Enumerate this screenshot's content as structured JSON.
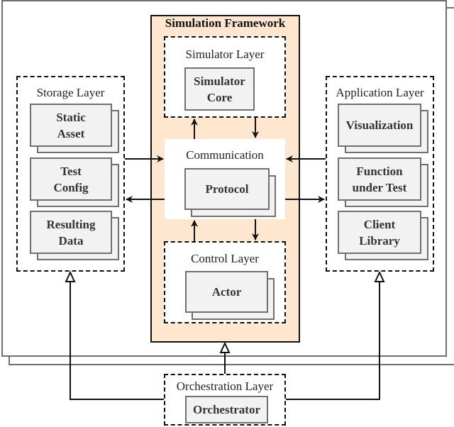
{
  "colors": {
    "framework_fill": "#fee6cf",
    "card_fill": "#f2f2f2",
    "card_border": "#707070",
    "frame_border": "#6e6e6e"
  },
  "framework": {
    "title": "Simulation Framework"
  },
  "simulator_layer": {
    "label": "Simulator Layer",
    "cards": [
      "Simulator\nCore"
    ]
  },
  "communication": {
    "label": "Communication",
    "cards": [
      "Protocol"
    ]
  },
  "control_layer": {
    "label": "Control Layer",
    "cards": [
      "Actor"
    ]
  },
  "storage_layer": {
    "label": "Storage Layer",
    "cards": [
      "Static\nAsset",
      "Test\nConfig",
      "Resulting\nData"
    ]
  },
  "application_layer": {
    "label": "Application Layer",
    "cards": [
      "Visualization",
      "Function\nunder Test",
      "Client\nLibrary"
    ]
  },
  "orchestration_layer": {
    "label": "Orchestration Layer",
    "cards": [
      "Orchestrator"
    ]
  }
}
